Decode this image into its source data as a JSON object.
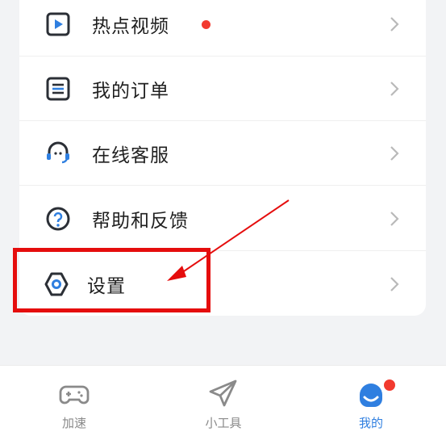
{
  "menu": {
    "items": [
      {
        "label": "热点视频",
        "icon": "play-video-icon",
        "badge": "red-dot"
      },
      {
        "label": "我的订单",
        "icon": "order-list-icon"
      },
      {
        "label": "在线客服",
        "icon": "headset-icon"
      },
      {
        "label": "帮助和反馈",
        "icon": "help-question-icon"
      },
      {
        "label": "设置",
        "icon": "settings-hexagon-icon"
      }
    ]
  },
  "tabbar": {
    "tabs": [
      {
        "label": "加速",
        "icon": "gamepad-icon",
        "active": false
      },
      {
        "label": "小工具",
        "icon": "paper-plane-icon",
        "active": false
      },
      {
        "label": "我的",
        "icon": "avatar-face-icon",
        "active": true
      }
    ]
  },
  "colors": {
    "accent": "#2f7fe0",
    "badge": "#f23a2f",
    "annotation": "#e50d0d",
    "icon_dark": "#2b2f36"
  }
}
